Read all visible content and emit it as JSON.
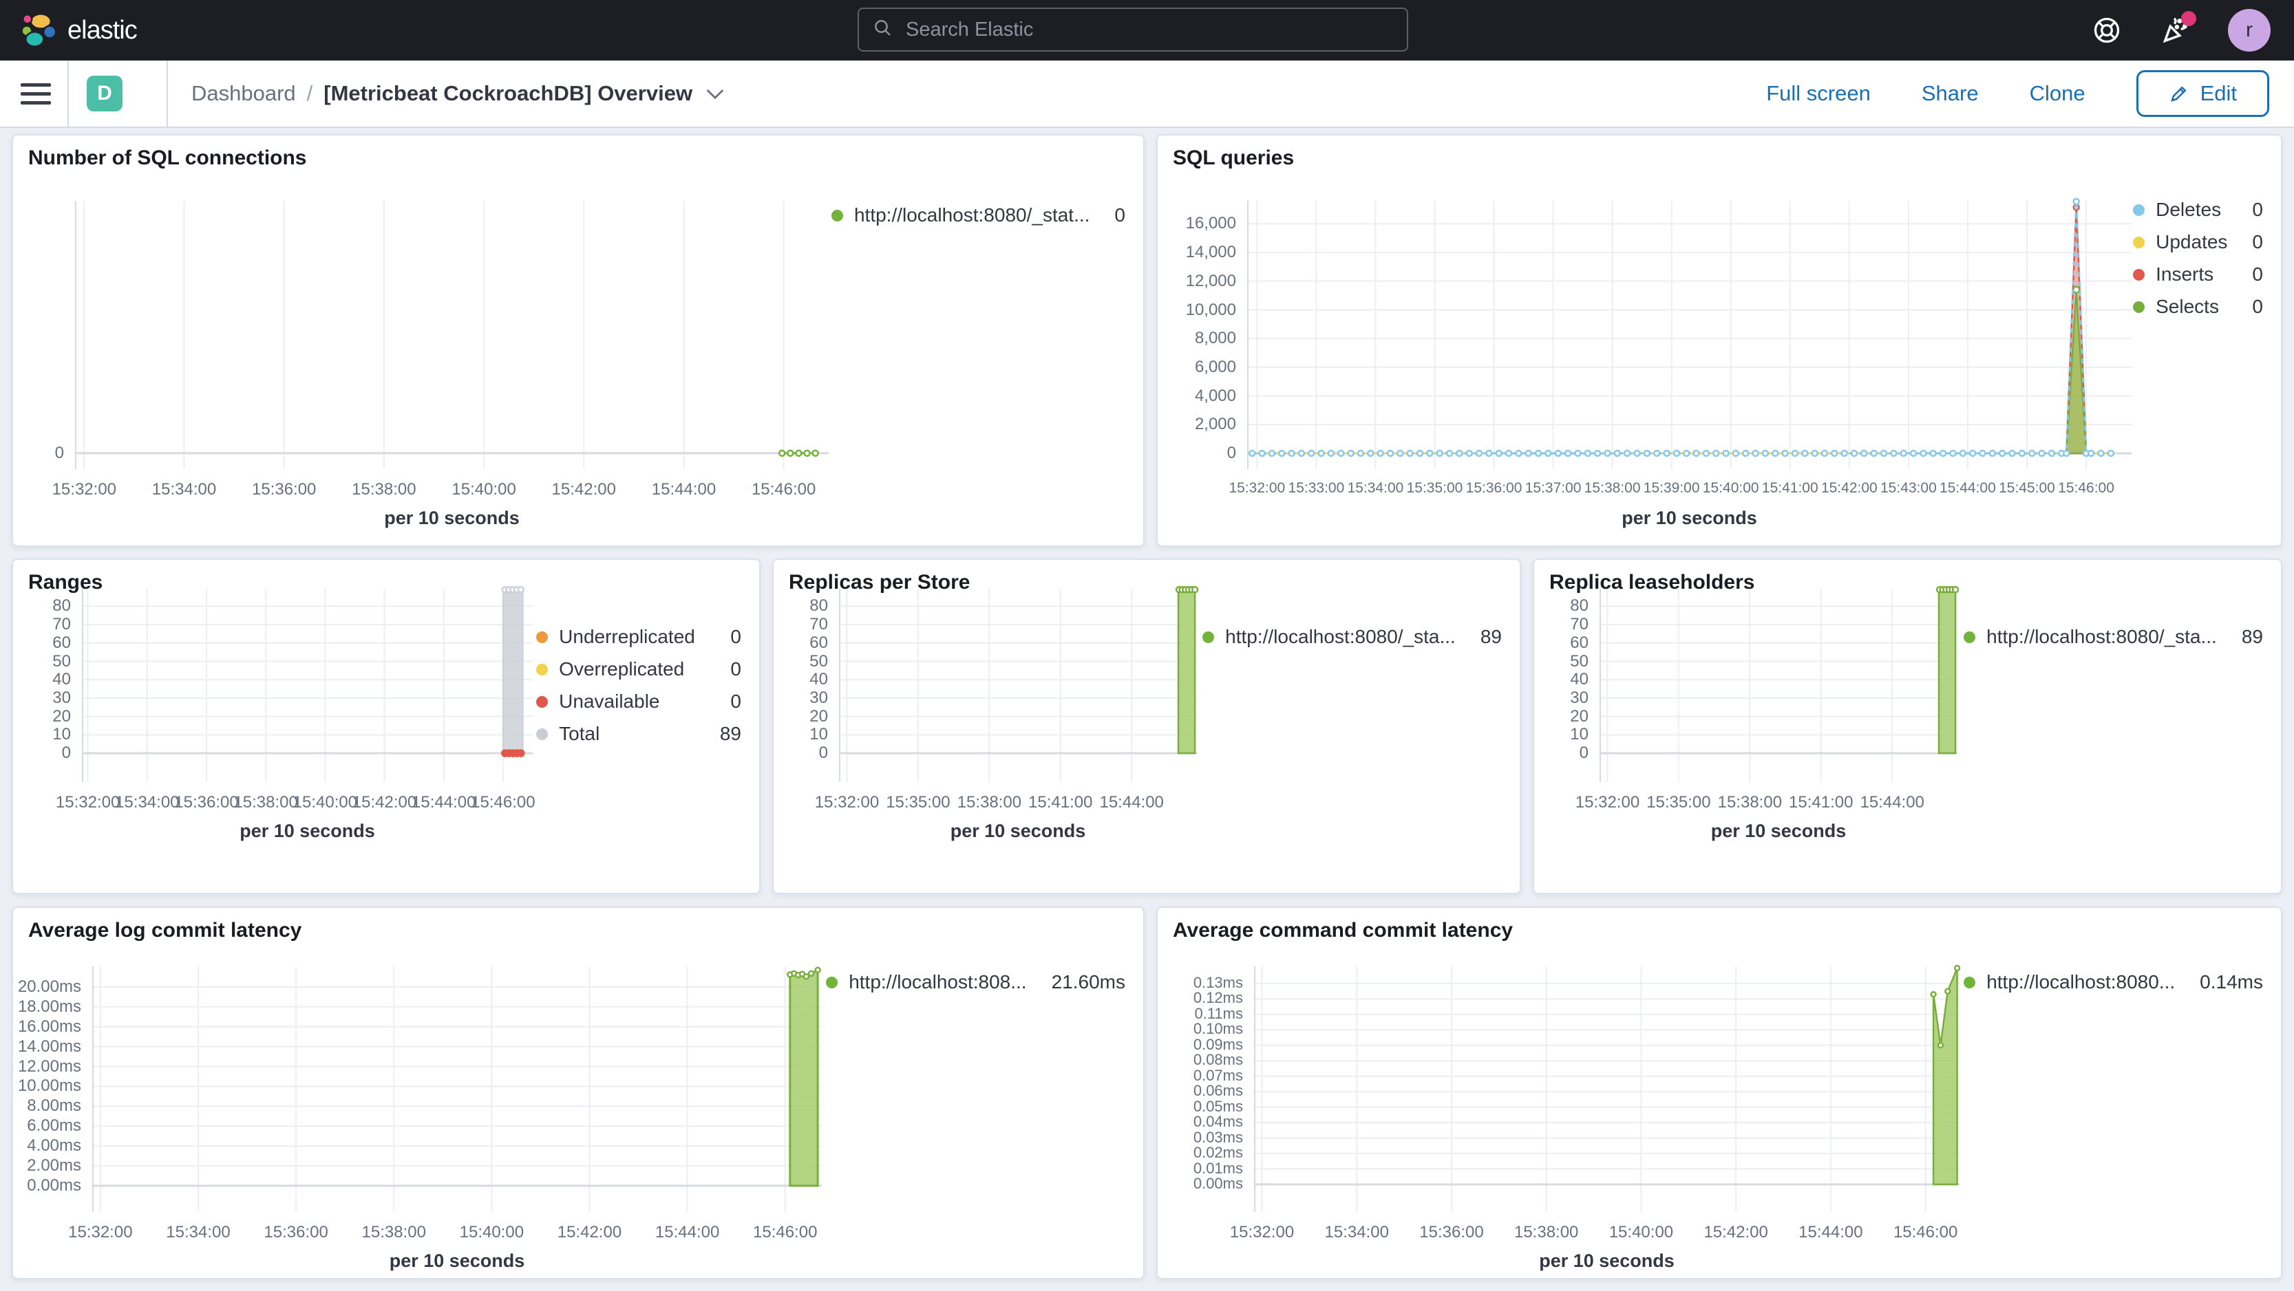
{
  "header": {
    "logo_text": "elastic",
    "search_placeholder": "Search Elastic",
    "avatar_initial": "r"
  },
  "toolbar": {
    "app_badge": "D",
    "breadcrumb_root": "Dashboard",
    "breadcrumb_separator": "/",
    "title": "[Metricbeat CockroachDB] Overview",
    "full_screen": "Full screen",
    "share": "Share",
    "clone": "Clone",
    "edit": "Edit"
  },
  "colors": {
    "header_bg": "#1d1e24",
    "link_blue": "#196fb5",
    "badge_teal": "#4dbea6",
    "series_green": "#72b33a",
    "series_blue": "#85c8ec",
    "series_yellow": "#f1d34b",
    "series_red": "#e2574b",
    "series_orange": "#ec9b3b",
    "series_gray": "#c9ccd2"
  },
  "charts": {
    "sql_connections": {
      "type": "line",
      "title": "Number of SQL connections",
      "xlabel": "per 10 seconds",
      "xlim": [
        "15:31:49",
        "15:46:54"
      ],
      "ylim": [
        -0.063,
        1
      ],
      "x_ticks": [
        "15:32:00",
        "15:34:00",
        "15:36:00",
        "15:38:00",
        "15:40:00",
        "15:42:00",
        "15:44:00",
        "15:46:00"
      ],
      "y_ticks": {
        "values": [
          0
        ],
        "labels": [
          "0"
        ]
      },
      "series": [
        {
          "name": "http://localhost:8080/_stat...",
          "color": "#72b33a",
          "type": "line",
          "width": 3,
          "dash": "7,7",
          "auto": {
            "from": "15:45:58",
            "to": "15:46:38",
            "step": 10,
            "value": 0
          },
          "markers": "points",
          "marker_r": 4
        }
      ],
      "legend": {
        "position": "right",
        "items": [
          {
            "label": "http://localhost:8080/_stat...",
            "value": "0",
            "color": "#72b33a"
          }
        ]
      }
    },
    "sql_queries": {
      "type": "area",
      "title": "SQL queries",
      "xlabel": "per 10 seconds",
      "xlim": [
        "15:31:50",
        "15:46:46"
      ],
      "ylim": [
        -1100,
        17600
      ],
      "x_ticks": [
        "15:32:00",
        "15:33:00",
        "15:34:00",
        "15:35:00",
        "15:36:00",
        "15:37:00",
        "15:38:00",
        "15:39:00",
        "15:40:00",
        "15:41:00",
        "15:42:00",
        "15:43:00",
        "15:44:00",
        "15:45:00",
        "15:46:00"
      ],
      "y_ticks": {
        "values": [
          0,
          2000,
          4000,
          6000,
          8000,
          10000,
          12000,
          14000,
          16000
        ],
        "labels": [
          "0",
          "2,000",
          "4,000",
          "6,000",
          "8,000",
          "10,000",
          "12,000",
          "14,000",
          "16,000"
        ]
      },
      "series": [
        {
          "name": "Updates",
          "color": "#f1d34b",
          "type": "line",
          "width": 2.5,
          "points": [
            [
              "15:31:55",
              0
            ],
            [
              "15:46:25",
              0
            ]
          ]
        },
        {
          "name": "Inserts",
          "color": "#e2574b",
          "fill": "rgba(226,87,75,0.45)",
          "type": "area",
          "width": 2.5,
          "points": [
            [
              "15:45:40",
              0
            ],
            [
              "15:45:50",
              17150
            ],
            [
              "15:46:00",
              0
            ]
          ],
          "markers": [
            [
              "15:45:50",
              17150
            ]
          ],
          "marker_r": 4
        },
        {
          "name": "Selects",
          "color": "#79ae3d",
          "fill": "rgba(147,193,80,0.75)",
          "type": "area",
          "width": 2.5,
          "points": [
            [
              "15:45:40",
              0
            ],
            [
              "15:45:50",
              11400
            ],
            [
              "15:46:00",
              0
            ]
          ],
          "markers": [
            [
              "15:45:50",
              11400
            ]
          ],
          "marker_r": 4.5
        },
        {
          "name": "Deletes",
          "color": "#85c8ec",
          "type": "line",
          "width": 3,
          "dash": "7,7",
          "auto": {
            "from": "15:31:55",
            "to": "15:46:25",
            "step": 10,
            "value": 0,
            "skip_from": "15:45:41",
            "skip_to": "15:45:59"
          },
          "points": [
            [
              "15:45:40",
              0
            ],
            [
              "15:45:50",
              17550
            ],
            [
              "15:46:00",
              0
            ]
          ],
          "markers": "points",
          "marker_r": 4
        }
      ],
      "legend": {
        "position": "right",
        "items": [
          {
            "label": "Deletes",
            "value": "0",
            "color": "#85c8ec"
          },
          {
            "label": "Updates",
            "value": "0",
            "color": "#f1d34b"
          },
          {
            "label": "Inserts",
            "value": "0",
            "color": "#e2574b"
          },
          {
            "label": "Selects",
            "value": "0",
            "color": "#79ae3d"
          }
        ]
      }
    },
    "ranges": {
      "type": "area",
      "title": "Ranges",
      "xlabel": "per 10 seconds",
      "xlim": [
        "15:31:48",
        "15:47:00"
      ],
      "ylim": [
        -15.7,
        89.5
      ],
      "x_ticks": [
        "15:32:00",
        "15:34:00",
        "15:36:00",
        "15:38:00",
        "15:40:00",
        "15:42:00",
        "15:44:00",
        "15:46:00"
      ],
      "y_ticks": {
        "values": [
          0,
          10,
          20,
          30,
          40,
          50,
          60,
          70,
          80
        ],
        "labels": [
          "0",
          "10",
          "20",
          "30",
          "40",
          "50",
          "60",
          "70",
          "80"
        ]
      },
      "series": [
        {
          "name": "Total",
          "color": "#cdd0d6",
          "fill": "rgba(205,208,214,0.85)",
          "type": "area",
          "width": 2,
          "points": [
            [
              "15:46:00",
              89
            ],
            [
              "15:46:40",
              89
            ]
          ],
          "markers": [
            [
              "15:46:04",
              89
            ],
            [
              "15:46:12",
              89
            ],
            [
              "15:46:20",
              89
            ],
            [
              "15:46:28",
              89
            ],
            [
              "15:46:36",
              89
            ]
          ],
          "marker_r": 4
        },
        {
          "name": "Underreplicated",
          "color": "#ec9b3b",
          "type": "points",
          "marker_fill": "#ec9b3b",
          "markers": [
            [
              "15:46:04",
              0
            ],
            [
              "15:46:12",
              0
            ],
            [
              "15:46:20",
              0
            ],
            [
              "15:46:28",
              0
            ],
            [
              "15:46:36",
              0
            ]
          ],
          "marker_r": 4.5
        },
        {
          "name": "Overreplicated",
          "color": "#f1d34b",
          "type": "points",
          "marker_fill": "#f1d34b",
          "markers": [
            [
              "15:46:04",
              0
            ],
            [
              "15:46:12",
              0
            ],
            [
              "15:46:20",
              0
            ],
            [
              "15:46:28",
              0
            ],
            [
              "15:46:36",
              0
            ]
          ],
          "marker_r": 4.5
        },
        {
          "name": "Unavailable",
          "color": "#e2574b",
          "type": "points",
          "marker_fill": "#e2574b",
          "markers": [
            [
              "15:46:04",
              0
            ],
            [
              "15:46:12",
              0
            ],
            [
              "15:46:20",
              0
            ],
            [
              "15:46:28",
              0
            ],
            [
              "15:46:36",
              0
            ]
          ],
          "marker_r": 4.5
        }
      ],
      "legend": {
        "position": "right",
        "items": [
          {
            "label": "Underreplicated",
            "value": "0",
            "color": "#ec9b3b"
          },
          {
            "label": "Overreplicated",
            "value": "0",
            "color": "#f1d34b"
          },
          {
            "label": "Unavailable",
            "value": "0",
            "color": "#e2574b"
          },
          {
            "label": "Total",
            "value": "89",
            "color": "#c9ccd2"
          }
        ]
      }
    },
    "replicas_per_store": {
      "type": "area",
      "title": "Replicas per Store",
      "xlabel": "per 10 seconds",
      "xlim": [
        "15:31:40",
        "15:46:45"
      ],
      "ylim": [
        -15.7,
        89.5
      ],
      "x_ticks": [
        "15:32:00",
        "15:35:00",
        "15:38:00",
        "15:41:00",
        "15:44:00"
      ],
      "y_ticks": {
        "values": [
          0,
          10,
          20,
          30,
          40,
          50,
          60,
          70,
          80
        ],
        "labels": [
          "0",
          "10",
          "20",
          "30",
          "40",
          "50",
          "60",
          "70",
          "80"
        ]
      },
      "series": [
        {
          "name": "http://localhost:8080/_sta...",
          "color": "#79ae3d",
          "fill": "rgba(160,202,100,0.8)",
          "type": "area",
          "width": 2.5,
          "points": [
            [
              "15:45:58",
              89
            ],
            [
              "15:46:40",
              89
            ]
          ],
          "markers": [
            [
              "15:46:00",
              89
            ],
            [
              "15:46:08",
              89
            ],
            [
              "15:46:16",
              89
            ],
            [
              "15:46:24",
              89
            ],
            [
              "15:46:32",
              89
            ],
            [
              "15:46:40",
              89
            ]
          ],
          "marker_r": 4
        }
      ],
      "legend": {
        "position": "right",
        "items": [
          {
            "label": "http://localhost:8080/_sta...",
            "value": "89",
            "color": "#72b33a"
          }
        ]
      }
    },
    "replica_leaseholders": {
      "type": "area",
      "title": "Replica leaseholders",
      "xlabel": "per 10 seconds",
      "xlim": [
        "15:31:40",
        "15:46:45"
      ],
      "ylim": [
        -15.7,
        89.5
      ],
      "x_ticks": [
        "15:32:00",
        "15:35:00",
        "15:38:00",
        "15:41:00",
        "15:44:00"
      ],
      "y_ticks": {
        "values": [
          0,
          10,
          20,
          30,
          40,
          50,
          60,
          70,
          80
        ],
        "labels": [
          "0",
          "10",
          "20",
          "30",
          "40",
          "50",
          "60",
          "70",
          "80"
        ]
      },
      "series": [
        {
          "name": "http://localhost:8080/_sta...",
          "color": "#79ae3d",
          "fill": "rgba(160,202,100,0.8)",
          "type": "area",
          "width": 2.5,
          "points": [
            [
              "15:45:58",
              89
            ],
            [
              "15:46:40",
              89
            ]
          ],
          "markers": [
            [
              "15:46:00",
              89
            ],
            [
              "15:46:08",
              89
            ],
            [
              "15:46:16",
              89
            ],
            [
              "15:46:24",
              89
            ],
            [
              "15:46:32",
              89
            ],
            [
              "15:46:40",
              89
            ]
          ],
          "marker_r": 4
        }
      ],
      "legend": {
        "position": "right",
        "items": [
          {
            "label": "http://localhost:8080/_sta...",
            "value": "89",
            "color": "#72b33a"
          }
        ]
      }
    },
    "avg_log_commit_latency": {
      "type": "area",
      "title": "Average log commit latency",
      "xlabel": "per 10 seconds",
      "xlim": [
        "15:31:50",
        "15:46:45"
      ],
      "ylim": [
        -2.63,
        22.07
      ],
      "x_ticks": [
        "15:32:00",
        "15:34:00",
        "15:36:00",
        "15:38:00",
        "15:40:00",
        "15:42:00",
        "15:44:00",
        "15:46:00"
      ],
      "y_ticks": {
        "values": [
          0,
          2,
          4,
          6,
          8,
          10,
          12,
          14,
          16,
          18,
          20
        ],
        "labels": [
          "0.00ms",
          "2.00ms",
          "4.00ms",
          "6.00ms",
          "8.00ms",
          "10.00ms",
          "12.00ms",
          "14.00ms",
          "16.00ms",
          "18.00ms",
          "20.00ms"
        ]
      },
      "series": [
        {
          "name": "http://localhost:808...",
          "color": "#79ae3d",
          "fill": "rgba(160,202,100,0.8)",
          "type": "area",
          "width": 3,
          "points": [
            [
              "15:46:06",
              21.25
            ],
            [
              "15:46:11",
              21.35
            ],
            [
              "15:46:16",
              21.2
            ],
            [
              "15:46:21",
              21.3
            ],
            [
              "15:46:26",
              21.05
            ],
            [
              "15:46:32",
              21.35
            ],
            [
              "15:46:40",
              21.7
            ]
          ],
          "markers": "points",
          "marker_r": 3.5
        }
      ],
      "legend": {
        "position": "right",
        "items": [
          {
            "label": "http://localhost:808...",
            "value": "21.60ms",
            "color": "#72b33a"
          }
        ]
      }
    },
    "avg_command_commit_latency": {
      "type": "area",
      "title": "Average command commit latency",
      "xlabel": "per 10 seconds",
      "xlim": [
        "15:31:50",
        "15:46:43"
      ],
      "ylim": [
        -0.0178,
        0.1411
      ],
      "x_ticks": [
        "15:32:00",
        "15:34:00",
        "15:36:00",
        "15:38:00",
        "15:40:00",
        "15:42:00",
        "15:44:00",
        "15:46:00"
      ],
      "y_ticks": {
        "values": [
          0,
          0.01,
          0.02,
          0.03,
          0.04,
          0.05,
          0.06,
          0.07,
          0.08,
          0.09,
          0.1,
          0.11,
          0.12,
          0.13
        ],
        "labels": [
          "0.00ms",
          "0.01ms",
          "0.02ms",
          "0.03ms",
          "0.04ms",
          "0.05ms",
          "0.06ms",
          "0.07ms",
          "0.08ms",
          "0.09ms",
          "0.10ms",
          "0.11ms",
          "0.12ms",
          "0.13ms"
        ]
      },
      "series": [
        {
          "name": "http://localhost:8080...",
          "color": "#79ae3d",
          "fill": "rgba(160,202,100,0.8)",
          "type": "area",
          "width": 2.5,
          "points": [
            [
              "15:46:10",
              0.123
            ],
            [
              "15:46:19",
              0.09
            ],
            [
              "15:46:28",
              0.125
            ],
            [
              "15:46:40",
              0.14
            ]
          ],
          "markers": "points",
          "marker_r": 3.5
        }
      ],
      "legend": {
        "position": "right",
        "items": [
          {
            "label": "http://localhost:8080...",
            "value": "0.14ms",
            "color": "#72b33a"
          }
        ]
      }
    }
  }
}
